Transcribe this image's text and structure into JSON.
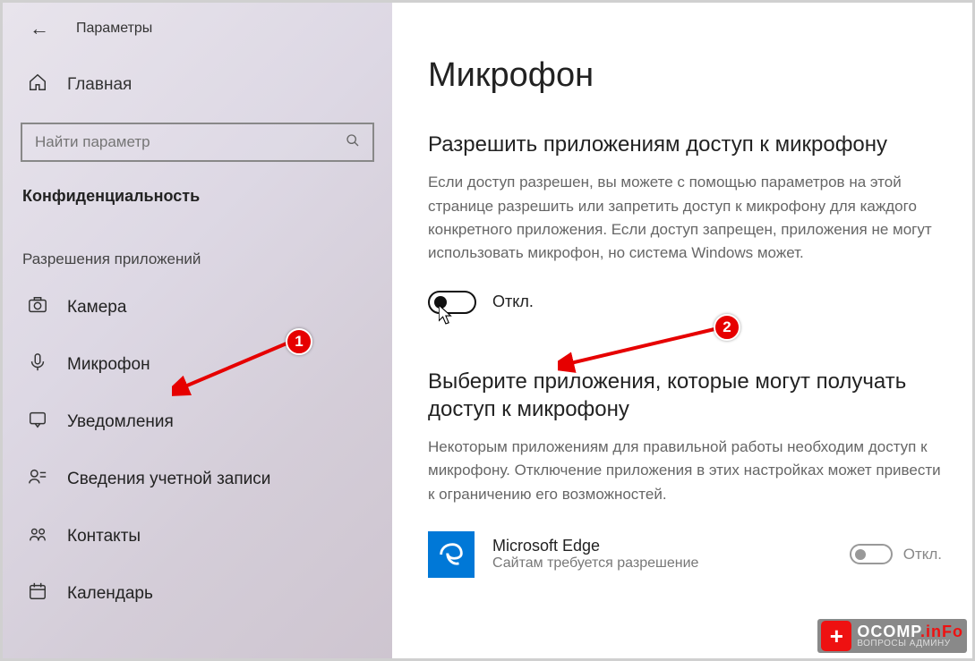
{
  "header": {
    "app_title": "Параметры"
  },
  "sidebar": {
    "home_label": "Главная",
    "search_placeholder": "Найти параметр",
    "category_label": "Конфиденциальность",
    "section_label": "Разрешения приложений",
    "items": [
      {
        "label": "Камера"
      },
      {
        "label": "Микрофон"
      },
      {
        "label": "Уведомления"
      },
      {
        "label": "Сведения учетной записи"
      },
      {
        "label": "Контакты"
      },
      {
        "label": "Календарь"
      }
    ]
  },
  "main": {
    "heading": "Микрофон",
    "allow_heading": "Разрешить приложениям доступ к микрофону",
    "allow_desc": "Если доступ разрешен, вы можете с помощью параметров на этой странице разрешить или запретить доступ к микрофону для каждого конкретного приложения. Если доступ запрещен, приложения не могут использовать микрофон, но система Windows может.",
    "toggle_state": "Откл.",
    "choose_heading": "Выберите приложения, которые могут получать доступ к микрофону",
    "choose_desc": "Некоторым приложениям для правильной работы необходим доступ к микрофону. Отключение приложения в этих настройках может привести к ограничению его возможностей.",
    "app": {
      "name": "Microsoft Edge",
      "subtext": "Сайтам требуется разрешение",
      "toggle_state": "Откл."
    }
  },
  "annotations": {
    "marker1": "1",
    "marker2": "2"
  },
  "watermark": {
    "main": "OCOMP",
    "suffix": ".inFo",
    "sub": "ВОПРОСЫ АДМИНУ"
  }
}
